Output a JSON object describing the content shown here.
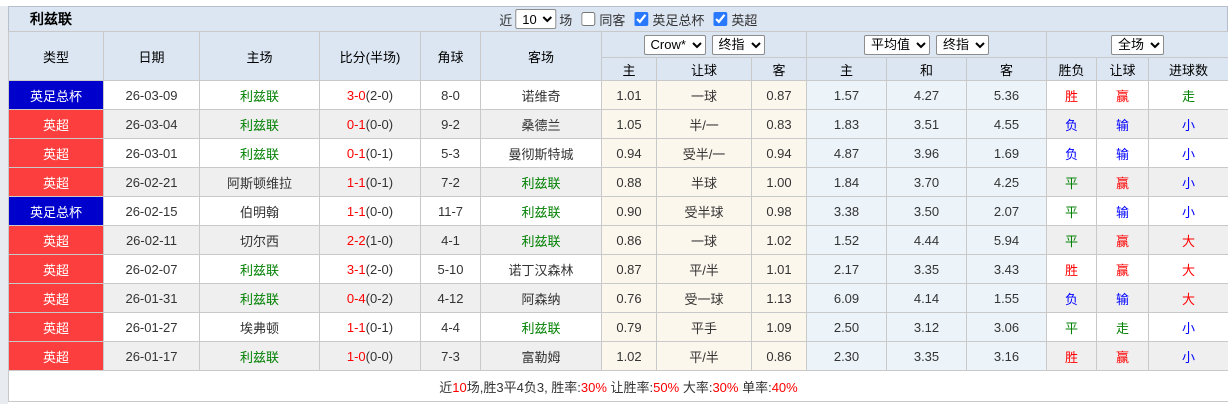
{
  "title": "利兹联",
  "controls": {
    "near_label": "近",
    "matches_value": "10",
    "games_label": "场",
    "same_away_label": "同客",
    "facup_label": "英足总杯",
    "epl_label": "英超"
  },
  "header": {
    "static_cols": [
      "类型",
      "日期",
      "主场",
      "比分(半场)",
      "角球",
      "客场"
    ],
    "asian_select_1": "Crow*",
    "asian_select_2": "终指",
    "euro_select_1": "平均值",
    "euro_select_2": "终指",
    "scope_select": "全场",
    "sub_cols": [
      "主",
      "让球",
      "客",
      "主",
      "和",
      "客",
      "胜负",
      "让球",
      "进球数"
    ]
  },
  "colors": {
    "facup_badge": "#0000cc",
    "epl_badge": "#fd3e3e",
    "leeds_green": "#008000",
    "team_dark": "#333333",
    "win_red": "#ff0000",
    "lose_blue": "#0000ff",
    "draw_green": "#008000"
  },
  "rows": [
    {
      "type": "英足总杯",
      "type_bg": "#0000cc",
      "date": "26-03-09",
      "home": "利兹联",
      "home_color": "#008000",
      "score": "3-0",
      "half": "(2-0)",
      "corner": "8-0",
      "away": "诺维奇",
      "away_color": "#333333",
      "a1": "1.01",
      "ah": "一球",
      "a3": "0.87",
      "e1": "1.57",
      "e2": "4.27",
      "e3": "5.36",
      "r1": "胜",
      "r1c": "#ff0000",
      "r2": "赢",
      "r2c": "#ff0000",
      "r3": "走",
      "r3c": "#008000"
    },
    {
      "type": "英超",
      "type_bg": "#fd3e3e",
      "date": "26-03-04",
      "home": "利兹联",
      "home_color": "#008000",
      "score": "0-1",
      "half": "(0-0)",
      "corner": "9-2",
      "away": "桑德兰",
      "away_color": "#333333",
      "a1": "1.05",
      "ah": "半/一",
      "a3": "0.83",
      "e1": "1.83",
      "e2": "3.51",
      "e3": "4.55",
      "r1": "负",
      "r1c": "#0000ff",
      "r2": "输",
      "r2c": "#0000ff",
      "r3": "小",
      "r3c": "#0000ff"
    },
    {
      "type": "英超",
      "type_bg": "#fd3e3e",
      "date": "26-03-01",
      "home": "利兹联",
      "home_color": "#008000",
      "score": "0-1",
      "half": "(0-1)",
      "corner": "5-3",
      "away": "曼彻斯特城",
      "away_color": "#333333",
      "a1": "0.94",
      "ah": "受半/一",
      "a3": "0.94",
      "e1": "4.87",
      "e2": "3.96",
      "e3": "1.69",
      "r1": "负",
      "r1c": "#0000ff",
      "r2": "输",
      "r2c": "#0000ff",
      "r3": "小",
      "r3c": "#0000ff"
    },
    {
      "type": "英超",
      "type_bg": "#fd3e3e",
      "date": "26-02-21",
      "home": "阿斯顿维拉",
      "home_color": "#333333",
      "score": "1-1",
      "half": "(0-1)",
      "corner": "7-2",
      "away": "利兹联",
      "away_color": "#008000",
      "a1": "0.88",
      "ah": "半球",
      "a3": "1.00",
      "e1": "1.84",
      "e2": "3.70",
      "e3": "4.25",
      "r1": "平",
      "r1c": "#008000",
      "r2": "赢",
      "r2c": "#ff0000",
      "r3": "小",
      "r3c": "#0000ff"
    },
    {
      "type": "英足总杯",
      "type_bg": "#0000cc",
      "date": "26-02-15",
      "home": "伯明翰",
      "home_color": "#333333",
      "score": "1-1",
      "half": "(0-0)",
      "corner": "11-7",
      "away": "利兹联",
      "away_color": "#008000",
      "a1": "0.90",
      "ah": "受半球",
      "a3": "0.98",
      "e1": "3.38",
      "e2": "3.50",
      "e3": "2.07",
      "r1": "平",
      "r1c": "#008000",
      "r2": "输",
      "r2c": "#0000ff",
      "r3": "小",
      "r3c": "#0000ff"
    },
    {
      "type": "英超",
      "type_bg": "#fd3e3e",
      "date": "26-02-11",
      "home": "切尔西",
      "home_color": "#333333",
      "score": "2-2",
      "half": "(1-0)",
      "corner": "4-1",
      "away": "利兹联",
      "away_color": "#008000",
      "a1": "0.86",
      "ah": "一球",
      "a3": "1.02",
      "e1": "1.52",
      "e2": "4.44",
      "e3": "5.94",
      "r1": "平",
      "r1c": "#008000",
      "r2": "赢",
      "r2c": "#ff0000",
      "r3": "大",
      "r3c": "#ff0000"
    },
    {
      "type": "英超",
      "type_bg": "#fd3e3e",
      "date": "26-02-07",
      "home": "利兹联",
      "home_color": "#008000",
      "score": "3-1",
      "half": "(2-0)",
      "corner": "5-10",
      "away": "诺丁汉森林",
      "away_color": "#333333",
      "a1": "0.87",
      "ah": "平/半",
      "a3": "1.01",
      "e1": "2.17",
      "e2": "3.35",
      "e3": "3.43",
      "r1": "胜",
      "r1c": "#ff0000",
      "r2": "赢",
      "r2c": "#ff0000",
      "r3": "大",
      "r3c": "#ff0000"
    },
    {
      "type": "英超",
      "type_bg": "#fd3e3e",
      "date": "26-01-31",
      "home": "利兹联",
      "home_color": "#008000",
      "score": "0-4",
      "half": "(0-2)",
      "corner": "4-12",
      "away": "阿森纳",
      "away_color": "#333333",
      "a1": "0.76",
      "ah": "受一球",
      "a3": "1.13",
      "e1": "6.09",
      "e2": "4.14",
      "e3": "1.55",
      "r1": "负",
      "r1c": "#0000ff",
      "r2": "输",
      "r2c": "#0000ff",
      "r3": "大",
      "r3c": "#ff0000"
    },
    {
      "type": "英超",
      "type_bg": "#fd3e3e",
      "date": "26-01-27",
      "home": "埃弗顿",
      "home_color": "#333333",
      "score": "1-1",
      "half": "(0-1)",
      "corner": "4-4",
      "away": "利兹联",
      "away_color": "#008000",
      "a1": "0.79",
      "ah": "平手",
      "a3": "1.09",
      "e1": "2.50",
      "e2": "3.12",
      "e3": "3.06",
      "r1": "平",
      "r1c": "#008000",
      "r2": "走",
      "r2c": "#008000",
      "r3": "小",
      "r3c": "#0000ff"
    },
    {
      "type": "英超",
      "type_bg": "#fd3e3e",
      "date": "26-01-17",
      "home": "利兹联",
      "home_color": "#008000",
      "score": "1-0",
      "half": "(0-0)",
      "corner": "7-3",
      "away": "富勒姆",
      "away_color": "#333333",
      "a1": "1.02",
      "ah": "平/半",
      "a3": "0.86",
      "e1": "2.30",
      "e2": "3.35",
      "e3": "3.16",
      "r1": "胜",
      "r1c": "#ff0000",
      "r2": "赢",
      "r2c": "#ff0000",
      "r3": "小",
      "r3c": "#0000ff"
    }
  ],
  "footer": {
    "segments": [
      {
        "t": "近",
        "c": "#333333"
      },
      {
        "t": "10",
        "c": "#ff0000"
      },
      {
        "t": "场,胜3平4负3, 胜率:",
        "c": "#333333"
      },
      {
        "t": "30%",
        "c": "#ff0000"
      },
      {
        "t": " 让胜率:",
        "c": "#333333"
      },
      {
        "t": "50%",
        "c": "#ff0000"
      },
      {
        "t": " 大率:",
        "c": "#333333"
      },
      {
        "t": "30%",
        "c": "#ff0000"
      },
      {
        "t": " 单率:",
        "c": "#333333"
      },
      {
        "t": "40%",
        "c": "#ff0000"
      }
    ]
  }
}
